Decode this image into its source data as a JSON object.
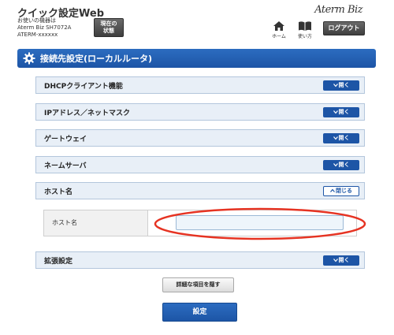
{
  "header": {
    "app_title": "クイック設定Web",
    "device_line1": "お使いの機器は",
    "device_line2": "Aterm Biz SH7072A",
    "device_line3": "ATERM-xxxxxx",
    "status_button_line1": "現在の",
    "status_button_line2": "状態",
    "logo": "Aterm Biz",
    "home_label": "ホーム",
    "guide_label": "使い方",
    "logout_label": "ログアウト"
  },
  "section": {
    "title": "接続先設定(ローカルルータ)"
  },
  "panels": [
    {
      "label": "DHCPクライアント機能",
      "toggle": "開く",
      "state": "collapsed"
    },
    {
      "label": "IPアドレス／ネットマスク",
      "toggle": "開く",
      "state": "collapsed"
    },
    {
      "label": "ゲートウェイ",
      "toggle": "開く",
      "state": "collapsed"
    },
    {
      "label": "ネームサーバ",
      "toggle": "開く",
      "state": "collapsed"
    },
    {
      "label": "ホスト名",
      "toggle": "閉じる",
      "state": "expanded"
    },
    {
      "label": "拡張設定",
      "toggle": "開く",
      "state": "collapsed"
    }
  ],
  "host_field": {
    "label": "ホスト名",
    "value": "",
    "placeholder": ""
  },
  "buttons": {
    "hide_details": "詳細な項目を隠す",
    "submit": "設定"
  },
  "colors": {
    "accent": "#1d55a6",
    "panel_bg": "#e8eff7",
    "highlight": "#e63322"
  }
}
